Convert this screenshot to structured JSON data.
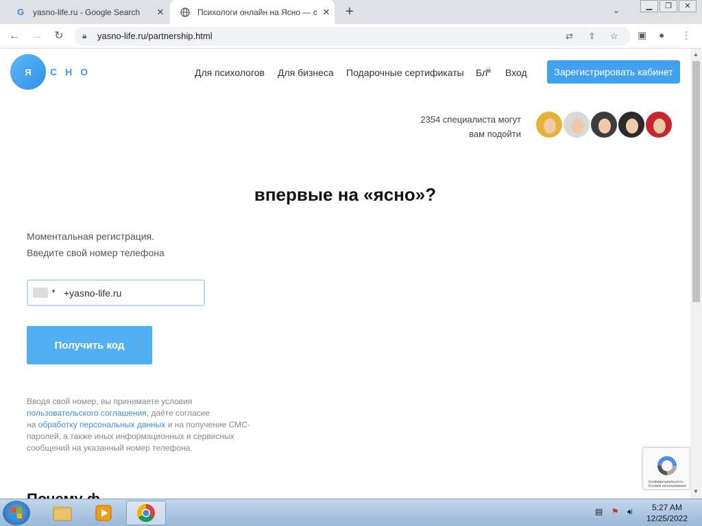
{
  "browser": {
    "tabs": [
      {
        "title": "yasno-life.ru - Google Search",
        "favicon": "G"
      },
      {
        "title": "Психологи онлайн на Ясно — с",
        "favicon": "globe-icon"
      }
    ],
    "new_tab": "+",
    "url": "yasno-life.ru/partnership.html"
  },
  "site": {
    "logo_circle": "Я",
    "logo_text": "СНО",
    "nav": [
      "Для психологов",
      "Для бизнеса",
      "Подарочные сертификаты",
      "Бл",
      "Вход"
    ],
    "register_button": "Зарегистрировать кабинет",
    "specialists_line1": "2354 специалиста могут",
    "specialists_line2": "вам подойти",
    "avatar_colors": [
      "#e7b23a",
      "#d9d9d9",
      "#3d3d3d",
      "#2b2b2b",
      "#c8262c"
    ],
    "headline": "впервые на «ясно»?",
    "intro_line1": "Моментальная регистрация.",
    "intro_line2": "Введите свой номер телефона",
    "phone_value": "+yasno-life.ru",
    "code_button": "Получить код",
    "terms": {
      "t1": "Вводя свой номер, вы принимаете условия",
      "link1": "пользовательского соглашения",
      "t2": ", даёте согласие",
      "t3": "на ",
      "link2": "обработку персональных данных",
      "t4": " и на получение СМС-паролей, а также иных информационных и сервисных сообщений на указанный номер телефона."
    },
    "bottom_text": "Почему ф",
    "recaptcha_text": "Конфиденциальность - Условия использования"
  },
  "taskbar": {
    "time": "5:27 AM",
    "date": "12/25/2022"
  },
  "colors": {
    "accent": "#43a2f0",
    "link": "#3d8fd6"
  }
}
